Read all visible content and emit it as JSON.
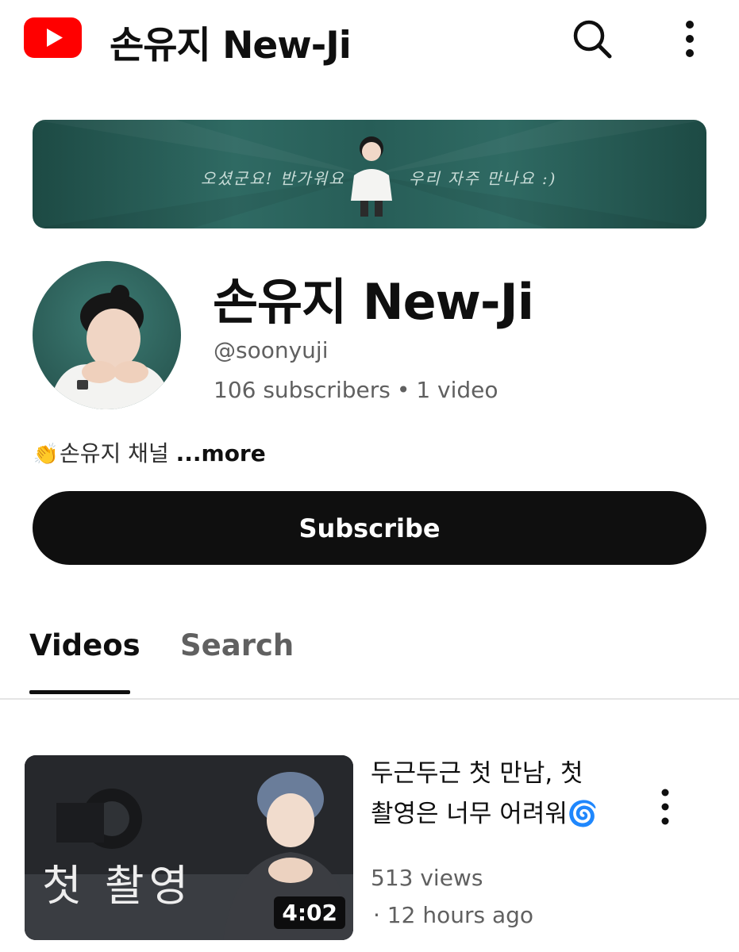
{
  "header": {
    "logo_icon": "youtube-play-icon",
    "title": "손유지 New-Ji",
    "search_icon": "search-icon",
    "menu_icon": "more-vert-icon",
    "brand_color": "#ff0000"
  },
  "banner": {
    "text_left": "오셨군요! 반가워요",
    "text_right": "우리 자주 만나요 :)"
  },
  "channel": {
    "name": "손유지 New-Ji",
    "handle": "@soonyuji",
    "subscribers": "106 subscribers",
    "separator": "•",
    "video_count": "1 video",
    "description_emoji": "👏",
    "description": "손유지 채널",
    "more_label": "...more",
    "subscribe_label": "Subscribe"
  },
  "tabs": [
    {
      "label": "Videos",
      "active": true
    },
    {
      "label": "Search",
      "active": false
    }
  ],
  "videos": [
    {
      "title": "두근두근 첫 만남, 첫 촬영은 너무 어려워",
      "title_emoji": "🌀",
      "thumbnail_caption": "첫 촬영",
      "duration": "4:02",
      "views": "513 views",
      "age": "· 12 hours ago",
      "menu_icon": "more-vert-icon"
    }
  ]
}
